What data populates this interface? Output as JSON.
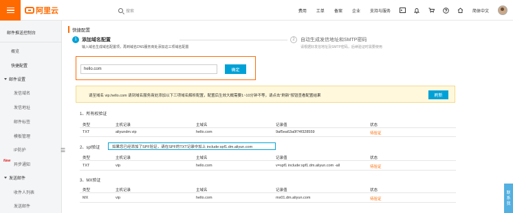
{
  "topbar": {
    "logo_text": "阿里云",
    "search_placeholder": "搜索",
    "nav": [
      "费用",
      "工单",
      "备案",
      "企业",
      "支持与服务"
    ],
    "language": "简体中文",
    "icons": [
      "terminal-icon",
      "bell-icon",
      "cart-icon",
      "help-icon",
      "home-icon"
    ]
  },
  "sidebar": {
    "title": "邮件推送控制台",
    "items": [
      {
        "label": "概览"
      },
      {
        "label": "快捷配置"
      }
    ],
    "groups": [
      {
        "label": "邮件设置",
        "subs": [
          "发信域名",
          "发信地址",
          "邮件标签",
          "模板管理",
          "IP防护",
          "异步通知"
        ]
      },
      {
        "label": "发送邮件",
        "subs": [
          "收件人列表",
          "发送邮件"
        ]
      }
    ],
    "new_badge": "New"
  },
  "main": {
    "breadcrumb": "快捷配置",
    "step1": {
      "num": "1",
      "title": "添加域名配置",
      "desc": "输入域名生成域名配置项，再到域名DNS服务商处添加这三项域名配置"
    },
    "step2": {
      "num": "2",
      "title": "自动生成发信地址和SMTP密码",
      "desc": "请根据好发信地址及SMTP密码，后续验证时需要使用"
    },
    "domain_input_value": "hello.com",
    "confirm_label": "确定",
    "notice_text": "请至域名 vip.hello.com 请到域名服务商处添加以下三项域名解析配置，配置后生效大概需要1~10分钟不等，请点击\"刷新\"按钮查看配置结果",
    "refresh_label": "刷新",
    "headers": [
      "类型",
      "主机记录",
      "主域名",
      "记录值",
      "状态"
    ],
    "sections": [
      {
        "title": "1、所有权验证",
        "row": [
          "TXT",
          "aliyundm.vip",
          "hello.com",
          "9af5ea63a0f74f328559",
          "待验证"
        ]
      },
      {
        "title": "2、spf验证",
        "tip": "如果您已经添加了SPF验证，请在SPF的TXT记录中加上 include:spf1.dm.aliyun.com",
        "row": [
          "TXT",
          "vip",
          "hello.com",
          "v=spf1 include:spf1.dm.aliyun.com -all",
          "待验证"
        ]
      },
      {
        "title": "3、MX验证",
        "row": [
          "MX",
          "vip",
          "hello.com",
          "mx01.dm.aliyun.com",
          "待验证"
        ]
      }
    ]
  },
  "side_widget": [
    "联",
    "系",
    "我"
  ],
  "colors": {
    "accent": "#ff6a00",
    "primary": "#00a1d6",
    "notice_bg": "#fff8dc"
  }
}
